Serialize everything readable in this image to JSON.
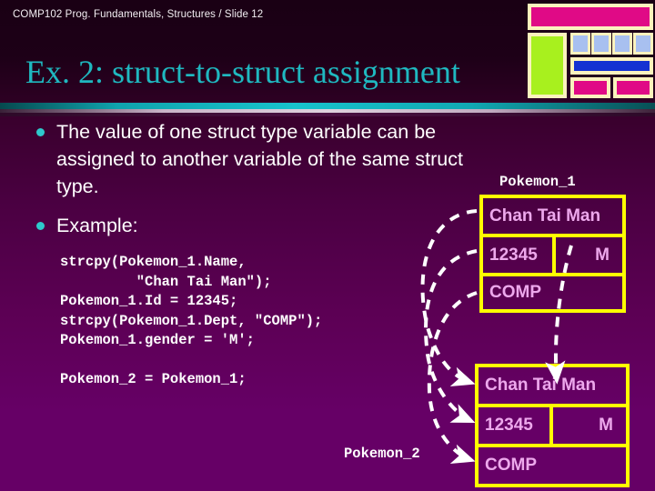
{
  "header": {
    "course_label": "COMP102 Prog. Fundamentals, Structures / Slide 12"
  },
  "title": "Ex. 2: struct-to-struct assignment",
  "bullets": [
    {
      "text": "The value of one struct type variable can be assigned to another variable of the same struct type."
    },
    {
      "text": "Example:"
    }
  ],
  "code": {
    "block1": "strcpy(Pokemon_1.Name,\n         \"Chan Tai Man\");\nPokemon_1.Id = 12345;\nstrcpy(Pokemon_1.Dept, \"COMP\");\nPokemon_1.gender = 'M';",
    "block2": "Pokemon_2 = Pokemon_1;"
  },
  "structs": [
    {
      "label": "Pokemon_1",
      "name_value": "Chan Tai Man",
      "id_value": "12345",
      "gender_value": "M",
      "dept_value": "COMP"
    },
    {
      "label": "Pokemon_2",
      "name_value": "Chan Tai Man",
      "id_value": "12345",
      "gender_value": "M",
      "dept_value": "COMP"
    }
  ],
  "colors": {
    "title": "#1fb8c0",
    "bullet_dot": "#2ec9cc",
    "struct_border": "#ffff00",
    "struct_text": "#eda8ec",
    "arrow": "#ffffff",
    "deco_frame": "#fbf3bd",
    "deco_magenta": "#e00a86",
    "deco_green": "#a8f01e",
    "deco_blue_square": "#a8c0f0",
    "deco_blue_bar": "#1432d2",
    "background_top": "#2a0020",
    "background_bottom": "#660066"
  },
  "decorations": [
    {
      "name": "magenta-bar",
      "color": "#e00a86"
    },
    {
      "name": "green-block",
      "color": "#a8f01e"
    },
    {
      "name": "blue-square",
      "color": "#a8c0f0"
    },
    {
      "name": "blue-bar",
      "color": "#1432d2"
    },
    {
      "name": "magenta-block",
      "color": "#e00a86"
    }
  ]
}
